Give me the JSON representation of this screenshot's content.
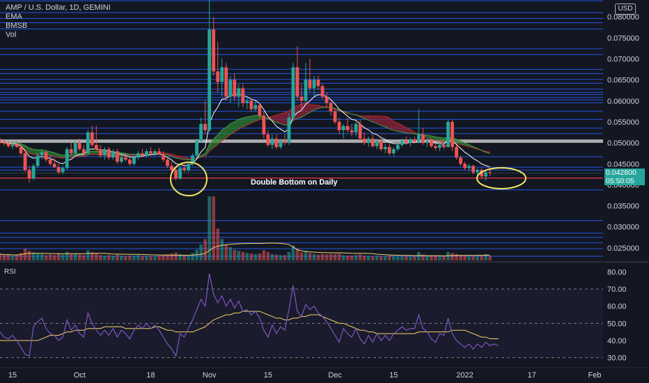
{
  "header": {
    "symbol_line": "AMP / U.S. Dollar, 1D, GEMINI",
    "indicators": [
      "EMA",
      "BMSB",
      "Vol"
    ],
    "currency": "USD"
  },
  "price_tags": {
    "last_price": "0.042800",
    "countdown": "05:50:05",
    "last_color": "#26a69a"
  },
  "annotation": "Double Bottom on Daily",
  "rsi_label": "RSI",
  "colors": {
    "background": "#131722",
    "up": "#26a69a",
    "down": "#ef5350",
    "level_line": "#2962ff",
    "support_line": "#f23645",
    "ema": "#ffffff",
    "rsi": "#7e57c2",
    "rsi_ma": "#f5d36a",
    "highlight_circle": "#f5e663"
  },
  "chart_data": [
    {
      "type": "candlestick",
      "title": "AMP / U.S. Dollar, 1D, GEMINI",
      "ylabel": "USD",
      "ylim": [
        0.022,
        0.084
      ],
      "yticks": [
        "0.025000",
        "0.030000",
        "0.035000",
        "0.040000",
        "0.045000",
        "0.050000",
        "0.055000",
        "0.060000",
        "0.065000",
        "0.070000",
        "0.075000",
        "0.080000"
      ],
      "ytick_values": [
        0.025,
        0.03,
        0.035,
        0.04,
        0.045,
        0.05,
        0.055,
        0.06,
        0.065,
        0.07,
        0.075,
        0.08
      ],
      "x_start_date": "2021-09-12",
      "x_end_date": "2022-02-03",
      "xticks": [
        {
          "label": "15",
          "date": "2021-09-15"
        },
        {
          "label": "Oct",
          "date": "2021-10-01"
        },
        {
          "label": "18",
          "date": "2021-10-18"
        },
        {
          "label": "Nov",
          "date": "2021-11-01"
        },
        {
          "label": "15",
          "date": "2021-11-15"
        },
        {
          "label": "Dec",
          "date": "2021-12-01"
        },
        {
          "label": "15",
          "date": "2021-12-15"
        },
        {
          "label": "2022",
          "date": "2022-01-01"
        },
        {
          "label": "17",
          "date": "2022-01-17"
        },
        {
          "label": "Feb",
          "date": "2022-02-01"
        }
      ],
      "first_candle_date": "2021-09-12",
      "ohlc": [
        [
          0.0505,
          0.0512,
          0.0498,
          0.0502
        ],
        [
          0.0502,
          0.0508,
          0.0494,
          0.0498
        ],
        [
          0.0498,
          0.0505,
          0.0488,
          0.0492
        ],
        [
          0.0492,
          0.05,
          0.0485,
          0.0496
        ],
        [
          0.0496,
          0.0504,
          0.0488,
          0.049
        ],
        [
          0.049,
          0.0495,
          0.047,
          0.0475
        ],
        [
          0.0475,
          0.048,
          0.043,
          0.0435
        ],
        [
          0.0435,
          0.0445,
          0.0405,
          0.0415
        ],
        [
          0.0415,
          0.045,
          0.041,
          0.0445
        ],
        [
          0.0445,
          0.0475,
          0.044,
          0.047
        ],
        [
          0.047,
          0.0485,
          0.046,
          0.0478
        ],
        [
          0.0478,
          0.0482,
          0.0455,
          0.046
        ],
        [
          0.046,
          0.047,
          0.0445,
          0.045
        ],
        [
          0.045,
          0.0465,
          0.044,
          0.0442
        ],
        [
          0.0442,
          0.045,
          0.0425,
          0.043
        ],
        [
          0.043,
          0.0445,
          0.0425,
          0.044
        ],
        [
          0.044,
          0.049,
          0.0435,
          0.0485
        ],
        [
          0.0485,
          0.05,
          0.047,
          0.0475
        ],
        [
          0.0475,
          0.0505,
          0.047,
          0.05
        ],
        [
          0.05,
          0.051,
          0.048,
          0.0485
        ],
        [
          0.0485,
          0.0495,
          0.047,
          0.0475
        ],
        [
          0.0475,
          0.053,
          0.047,
          0.0525
        ],
        [
          0.0525,
          0.054,
          0.049,
          0.0495
        ],
        [
          0.0495,
          0.054,
          0.048,
          0.0485
        ],
        [
          0.0485,
          0.0495,
          0.0465,
          0.047
        ],
        [
          0.047,
          0.049,
          0.046,
          0.0485
        ],
        [
          0.0485,
          0.049,
          0.046,
          0.0465
        ],
        [
          0.0465,
          0.0485,
          0.046,
          0.048
        ],
        [
          0.048,
          0.0485,
          0.045,
          0.0455
        ],
        [
          0.0455,
          0.047,
          0.045,
          0.0465
        ],
        [
          0.0465,
          0.0475,
          0.0455,
          0.046
        ],
        [
          0.046,
          0.0465,
          0.0445,
          0.045
        ],
        [
          0.045,
          0.047,
          0.0445,
          0.0465
        ],
        [
          0.0465,
          0.048,
          0.046,
          0.0475
        ],
        [
          0.0475,
          0.0485,
          0.0465,
          0.047
        ],
        [
          0.047,
          0.0485,
          0.0465,
          0.048
        ],
        [
          0.048,
          0.049,
          0.047,
          0.0475
        ],
        [
          0.0475,
          0.0485,
          0.0468,
          0.048
        ],
        [
          0.048,
          0.0488,
          0.047,
          0.0472
        ],
        [
          0.0472,
          0.048,
          0.0455,
          0.046
        ],
        [
          0.046,
          0.0465,
          0.044,
          0.0445
        ],
        [
          0.0445,
          0.0455,
          0.043,
          0.0435
        ],
        [
          0.0435,
          0.044,
          0.041,
          0.0415
        ],
        [
          0.0415,
          0.0445,
          0.0412,
          0.044
        ],
        [
          0.044,
          0.045,
          0.043,
          0.0435
        ],
        [
          0.0435,
          0.0455,
          0.043,
          0.045
        ],
        [
          0.045,
          0.0475,
          0.0445,
          0.047
        ],
        [
          0.047,
          0.051,
          0.0465,
          0.0505
        ],
        [
          0.0505,
          0.056,
          0.05,
          0.0545
        ],
        [
          0.0545,
          0.06,
          0.052,
          0.053
        ],
        [
          0.053,
          0.084,
          0.0525,
          0.077
        ],
        [
          0.077,
          0.08,
          0.066,
          0.067
        ],
        [
          0.067,
          0.074,
          0.062,
          0.0645
        ],
        [
          0.0645,
          0.07,
          0.061,
          0.068
        ],
        [
          0.068,
          0.069,
          0.06,
          0.061
        ],
        [
          0.061,
          0.066,
          0.0595,
          0.065
        ],
        [
          0.065,
          0.0665,
          0.06,
          0.061
        ],
        [
          0.061,
          0.064,
          0.0585,
          0.063
        ],
        [
          0.063,
          0.064,
          0.0585,
          0.0595
        ],
        [
          0.0595,
          0.061,
          0.058,
          0.06
        ],
        [
          0.06,
          0.0605,
          0.0575,
          0.058
        ],
        [
          0.058,
          0.06,
          0.0575,
          0.059
        ],
        [
          0.059,
          0.0595,
          0.056,
          0.0565
        ],
        [
          0.0565,
          0.0575,
          0.051,
          0.052
        ],
        [
          0.052,
          0.053,
          0.049,
          0.0495
        ],
        [
          0.0495,
          0.052,
          0.0485,
          0.051
        ],
        [
          0.051,
          0.052,
          0.0485,
          0.049
        ],
        [
          0.049,
          0.051,
          0.0485,
          0.0505
        ],
        [
          0.0505,
          0.052,
          0.0495,
          0.05
        ],
        [
          0.05,
          0.057,
          0.0495,
          0.056
        ],
        [
          0.056,
          0.069,
          0.0555,
          0.068
        ],
        [
          0.068,
          0.073,
          0.06,
          0.061
        ],
        [
          0.061,
          0.064,
          0.058,
          0.06
        ],
        [
          0.06,
          0.069,
          0.0595,
          0.065
        ],
        [
          0.065,
          0.07,
          0.062,
          0.063
        ],
        [
          0.063,
          0.066,
          0.061,
          0.065
        ],
        [
          0.065,
          0.066,
          0.0625,
          0.0635
        ],
        [
          0.0635,
          0.064,
          0.0605,
          0.061
        ],
        [
          0.061,
          0.062,
          0.0585,
          0.0595
        ],
        [
          0.0595,
          0.06,
          0.0565,
          0.0575
        ],
        [
          0.0575,
          0.058,
          0.0545,
          0.055
        ],
        [
          0.055,
          0.056,
          0.052,
          0.053
        ],
        [
          0.053,
          0.0545,
          0.051,
          0.054
        ],
        [
          0.054,
          0.056,
          0.0525,
          0.053
        ],
        [
          0.053,
          0.0545,
          0.0515,
          0.0525
        ],
        [
          0.0525,
          0.055,
          0.0515,
          0.0545
        ],
        [
          0.0545,
          0.0555,
          0.0505,
          0.051
        ],
        [
          0.051,
          0.0525,
          0.0495,
          0.05
        ],
        [
          0.05,
          0.0515,
          0.049,
          0.051
        ],
        [
          0.051,
          0.052,
          0.0488,
          0.0492
        ],
        [
          0.0492,
          0.051,
          0.0485,
          0.0505
        ],
        [
          0.0505,
          0.0512,
          0.048,
          0.0485
        ],
        [
          0.0485,
          0.0498,
          0.0475,
          0.049
        ],
        [
          0.049,
          0.05,
          0.047,
          0.0475
        ],
        [
          0.0475,
          0.049,
          0.0468,
          0.0485
        ],
        [
          0.0485,
          0.05,
          0.048,
          0.0495
        ],
        [
          0.0495,
          0.051,
          0.049,
          0.0505
        ],
        [
          0.0505,
          0.0515,
          0.0495,
          0.05
        ],
        [
          0.05,
          0.0512,
          0.0492,
          0.0508
        ],
        [
          0.0508,
          0.0515,
          0.0498,
          0.0502
        ],
        [
          0.0502,
          0.058,
          0.05,
          0.052
        ],
        [
          0.052,
          0.0535,
          0.0495,
          0.05
        ],
        [
          0.05,
          0.0512,
          0.049,
          0.0505
        ],
        [
          0.0505,
          0.051,
          0.0488,
          0.0492
        ],
        [
          0.0492,
          0.05,
          0.0482,
          0.0488
        ],
        [
          0.0488,
          0.0498,
          0.048,
          0.0495
        ],
        [
          0.0495,
          0.0505,
          0.0485,
          0.049
        ],
        [
          0.049,
          0.0555,
          0.0488,
          0.055
        ],
        [
          0.055,
          0.0555,
          0.048,
          0.049
        ],
        [
          0.049,
          0.0495,
          0.046,
          0.0465
        ],
        [
          0.0465,
          0.047,
          0.0445,
          0.045
        ],
        [
          0.045,
          0.0455,
          0.0435,
          0.044
        ],
        [
          0.044,
          0.045,
          0.0432,
          0.0445
        ],
        [
          0.0445,
          0.0448,
          0.0425,
          0.043
        ],
        [
          0.043,
          0.044,
          0.042,
          0.0435
        ],
        [
          0.0435,
          0.044,
          0.0415,
          0.042
        ],
        [
          0.042,
          0.0435,
          0.041,
          0.043
        ],
        [
          0.043,
          0.044,
          0.042,
          0.0428
        ]
      ],
      "volume": [
        1.2,
        1.0,
        1.1,
        0.9,
        1.0,
        1.4,
        2.2,
        1.8,
        1.5,
        1.3,
        1.2,
        1.0,
        1.1,
        1.0,
        1.3,
        1.1,
        1.6,
        1.2,
        1.3,
        1.1,
        1.0,
        1.9,
        1.5,
        1.3,
        1.0,
        0.9,
        1.0,
        0.9,
        1.1,
        0.9,
        0.8,
        0.9,
        0.9,
        1.0,
        0.8,
        0.9,
        0.8,
        0.8,
        0.9,
        1.0,
        1.1,
        1.3,
        1.5,
        1.2,
        0.9,
        1.0,
        1.4,
        2.0,
        3.0,
        4.0,
        12.0,
        12.0,
        6.0,
        4.0,
        3.0,
        2.5,
        2.0,
        1.8,
        1.6,
        1.4,
        1.3,
        1.2,
        1.3,
        1.9,
        1.6,
        1.2,
        1.1,
        1.0,
        1.0,
        1.6,
        2.8,
        2.2,
        1.5,
        1.8,
        1.4,
        1.2,
        1.1,
        1.2,
        1.1,
        1.2,
        1.2,
        1.3,
        1.0,
        0.9,
        0.9,
        1.0,
        1.1,
        0.9,
        0.9,
        0.8,
        0.9,
        0.8,
        0.8,
        0.9,
        0.8,
        0.8,
        0.8,
        0.8,
        0.7,
        0.7,
        1.6,
        1.1,
        0.8,
        0.8,
        0.8,
        0.7,
        0.8,
        1.6,
        1.4,
        1.2,
        1.0,
        0.9,
        0.9,
        0.8,
        0.9,
        1.0,
        1.2,
        0.9
      ],
      "rsi": {
        "ylim": [
          25,
          85
        ],
        "yticks": [
          "30.00",
          "40.00",
          "50.00",
          "60.00",
          "70.00",
          "80.00"
        ],
        "ytick_values": [
          30,
          40,
          50,
          60,
          70,
          80
        ],
        "band_levels": [
          30,
          50,
          70
        ],
        "rsi_values": [
          45,
          42,
          41,
          43,
          40,
          36,
          32,
          31,
          48,
          51,
          53,
          47,
          44,
          43,
          40,
          42,
          52,
          46,
          49,
          44,
          42,
          56,
          50,
          46,
          43,
          46,
          43,
          47,
          42,
          46,
          44,
          41,
          46,
          49,
          47,
          50,
          47,
          49,
          46,
          42,
          38,
          35,
          31,
          44,
          42,
          47,
          52,
          58,
          64,
          60,
          79,
          67,
          62,
          66,
          60,
          64,
          59,
          63,
          57,
          58,
          55,
          57,
          53,
          46,
          42,
          49,
          44,
          48,
          46,
          58,
          72,
          57,
          54,
          61,
          58,
          60,
          56,
          54,
          51,
          47,
          43,
          39,
          47,
          44,
          42,
          47,
          41,
          38,
          43,
          39,
          44,
          40,
          43,
          40,
          44,
          46,
          48,
          46,
          47,
          47,
          55,
          47,
          45,
          41,
          39,
          44,
          43,
          53,
          44,
          40,
          38,
          36,
          38,
          35,
          38,
          36,
          39,
          37,
          38,
          37
        ],
        "ma_values": [
          40,
          40,
          40,
          40,
          40,
          40,
          40,
          40,
          40,
          40,
          41,
          42,
          43,
          43,
          43,
          44,
          45,
          45,
          46,
          46,
          46,
          47,
          47,
          47,
          47,
          48,
          48,
          48,
          48,
          48,
          47,
          47,
          47,
          47,
          47,
          47,
          47,
          48,
          48,
          47,
          46,
          46,
          45,
          45,
          45,
          45,
          45,
          46,
          47,
          48,
          50,
          52,
          53,
          54,
          55,
          55,
          56,
          56,
          57,
          57,
          57,
          57,
          57,
          56,
          55,
          54,
          53,
          53,
          52,
          52,
          53,
          53,
          54,
          54,
          55,
          55,
          55,
          54,
          53,
          52,
          51,
          50,
          50,
          49,
          48,
          47,
          46,
          46,
          45,
          45,
          44,
          44,
          44,
          44,
          44,
          44,
          44,
          44,
          44,
          44,
          45,
          45,
          45,
          45,
          45,
          45,
          45,
          45,
          46,
          46,
          46,
          46,
          45,
          44,
          43,
          42,
          42,
          41,
          41,
          41
        ]
      }
    }
  ]
}
